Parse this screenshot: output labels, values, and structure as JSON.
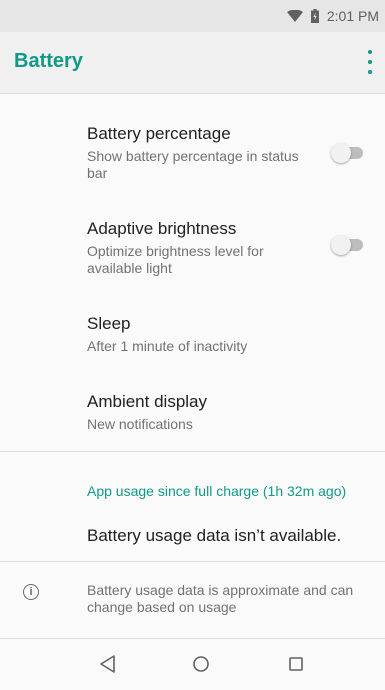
{
  "status_bar": {
    "time": "2:01 PM",
    "icons": [
      "wifi-icon",
      "battery-icon"
    ]
  },
  "app_bar": {
    "title": "Battery",
    "menu_icon": "more-vert-icon"
  },
  "preferences": [
    {
      "title": "Battery percentage",
      "summary": "Show battery percentage in status bar",
      "toggle": false
    },
    {
      "title": "Adaptive brightness",
      "summary": "Optimize brightness level for available light",
      "toggle": false
    },
    {
      "title": "Sleep",
      "summary": "After 1 minute of inactivity"
    },
    {
      "title": "Ambient display",
      "summary": "New notifications"
    }
  ],
  "usage": {
    "header": "App usage since full charge (1h 32m ago)",
    "message": "Battery usage data isn’t available."
  },
  "footer_info": {
    "icon": "info-icon",
    "text": "Battery usage data is approximate and can change based on usage"
  },
  "nav_bar": {
    "buttons": [
      "back-icon",
      "home-icon",
      "recents-icon"
    ]
  },
  "colors": {
    "accent": "#0f9a88",
    "toggle_off": "#bdbdbd"
  }
}
